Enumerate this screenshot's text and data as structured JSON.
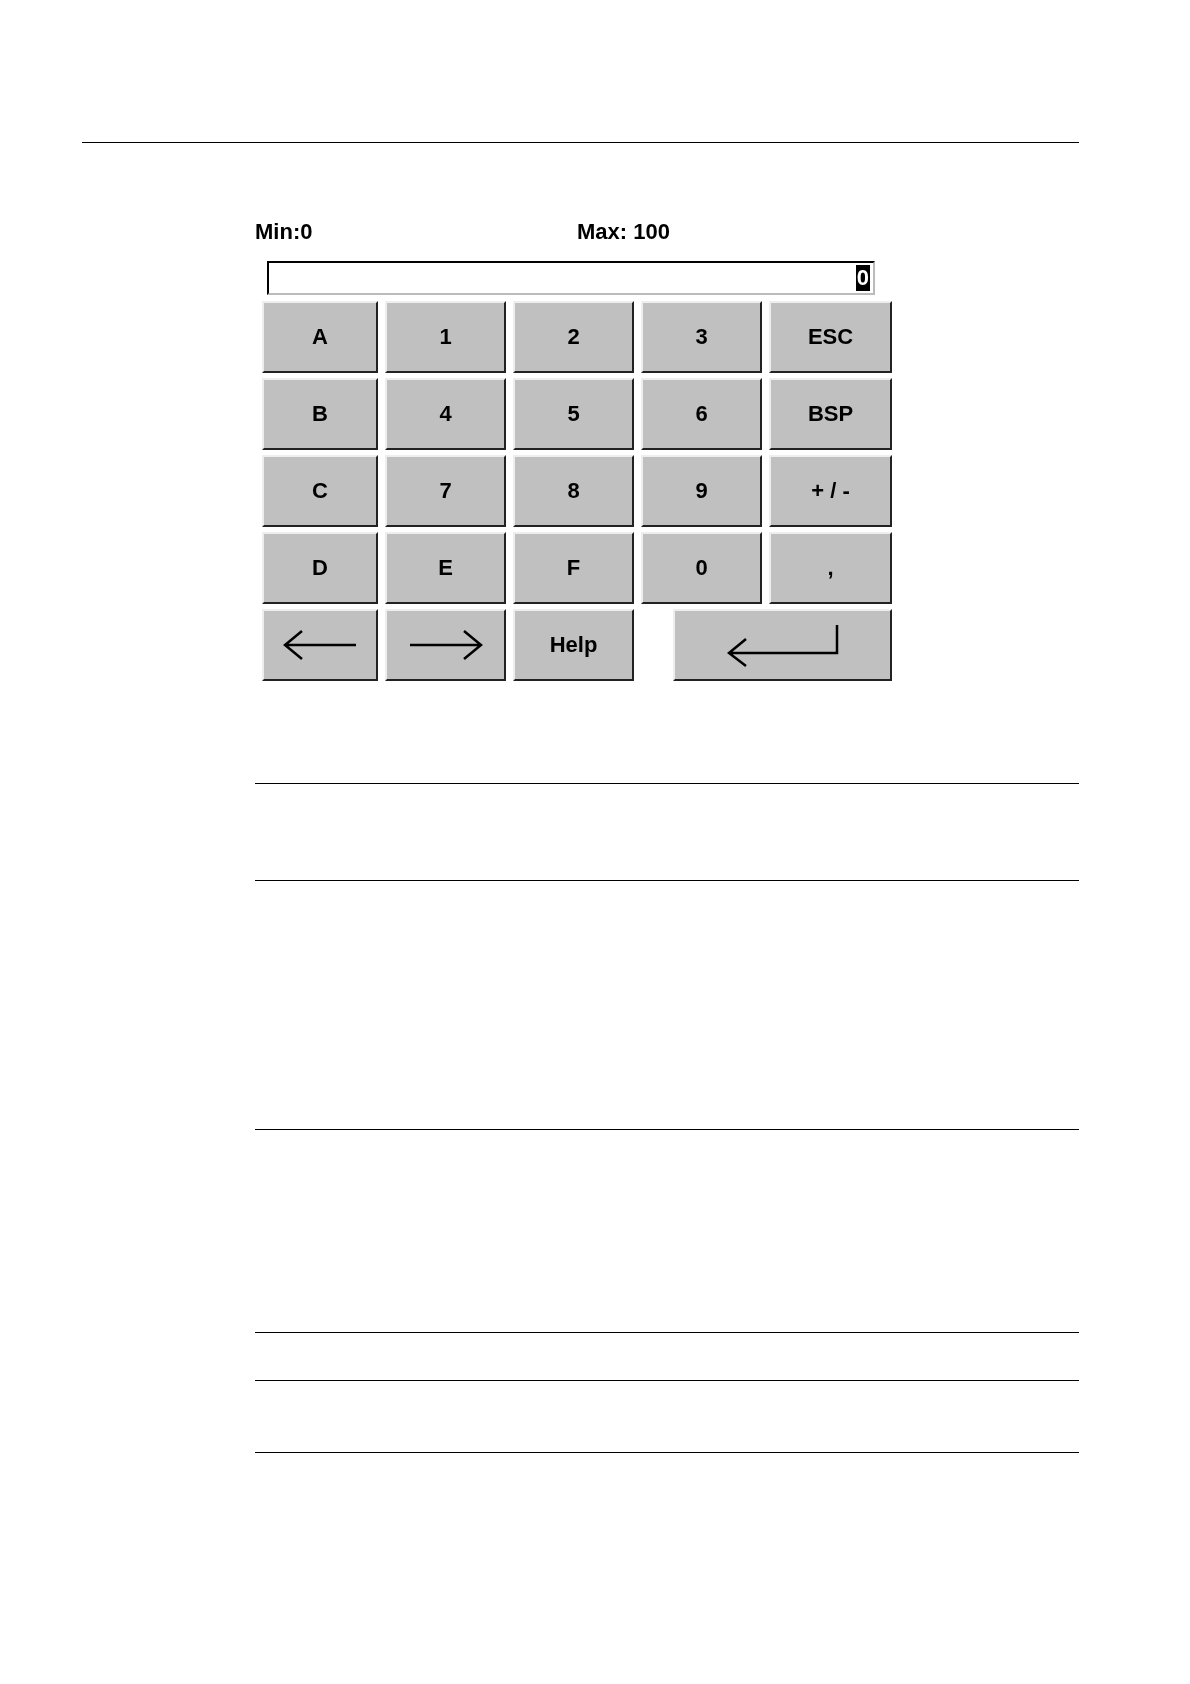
{
  "limits": {
    "min": "Min:0",
    "max": "Max: 100"
  },
  "entry_field": {
    "value": "0",
    "value_selected": true
  },
  "keys": [
    [
      {
        "kind": "text",
        "label": "A"
      },
      {
        "kind": "text",
        "label": "1"
      },
      {
        "kind": "text",
        "label": "2"
      },
      {
        "kind": "text",
        "label": "3"
      },
      {
        "kind": "text",
        "label": "ESC"
      }
    ],
    [
      {
        "kind": "text",
        "label": "B"
      },
      {
        "kind": "text",
        "label": "4"
      },
      {
        "kind": "text",
        "label": "5"
      },
      {
        "kind": "text",
        "label": "6"
      },
      {
        "kind": "text",
        "label": "BSP"
      }
    ],
    [
      {
        "kind": "text",
        "label": "C"
      },
      {
        "kind": "text",
        "label": "7"
      },
      {
        "kind": "text",
        "label": "8"
      },
      {
        "kind": "text",
        "label": "9"
      },
      {
        "kind": "text",
        "label": "+ / -"
      }
    ],
    [
      {
        "kind": "text",
        "label": "D"
      },
      {
        "kind": "text",
        "label": "E"
      },
      {
        "kind": "text",
        "label": "F"
      },
      {
        "kind": "text",
        "label": "0"
      },
      {
        "kind": "text",
        "label": ","
      }
    ],
    [
      {
        "kind": "arrow-left"
      },
      {
        "kind": "arrow-right"
      },
      {
        "kind": "text",
        "label": "Help"
      },
      {
        "kind": "enter"
      }
    ]
  ]
}
